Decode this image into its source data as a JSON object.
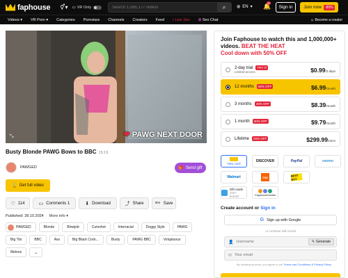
{
  "header": {
    "logo": "faphouse",
    "vr_only_label": "VR Only",
    "search_placeholder": "Search 1,586,177 videos",
    "language": "EN",
    "notification_count": "20",
    "signin_label": "Sign in",
    "join_label": "Join now",
    "join_discount": "-50%"
  },
  "nav": {
    "items": [
      "Videos",
      "VR Porn",
      "Categories",
      "Pornstars",
      "Channels",
      "Creators",
      "Feed"
    ],
    "live": "• Live Sex",
    "sex_chat": "Sex Chat",
    "creator_link": "Become a creator"
  },
  "video": {
    "watermark": "PAWG NEXT DOOR",
    "title": "Busty Blonde PAWG Bows to BBC",
    "duration": "15:19",
    "channel": "PAWGED",
    "send_gift": "Send gift",
    "full_video": "Get full video",
    "likes": "114",
    "comments": "Comments 1",
    "download": "Download",
    "share": "Share",
    "save": "Save",
    "published": "Published: 28.10.2024",
    "more_info": "More info",
    "tags": [
      "Blonde",
      "Blowjob",
      "Cumshot",
      "Interracial",
      "Doggy Style",
      "PAWG",
      "Big Tits",
      "BBC",
      "Ass",
      "Big Black Cock...",
      "Busty",
      "PAWG BBC",
      "Voluptuous",
      "Melons"
    ]
  },
  "panel": {
    "headline_1": "Join Faphouse to watch this and 1,000,000+ videos.",
    "headline_red": "BEAT THE HEAT",
    "headline_2": "Cool down with 50% OFF",
    "plans": [
      {
        "name": "2-day trial",
        "badge": "TRY IT",
        "sub": "Limited access",
        "price": "$0.99",
        "per": "/2 days",
        "selected": false
      },
      {
        "name": "12 months",
        "badge": "50% OFF",
        "sub": "",
        "price": "$6.99",
        "per": "/month",
        "selected": true
      },
      {
        "name": "3 months",
        "badge": "40% OFF",
        "sub": "",
        "price": "$8.39",
        "per": "/month",
        "selected": false
      },
      {
        "name": "1 month",
        "badge": "30% OFF",
        "sub": "",
        "price": "$9.79",
        "per": "/month",
        "selected": false
      },
      {
        "name": "Lifetime",
        "badge": "25% OFF",
        "sub": "",
        "price": "$299.99",
        "per": "/once",
        "selected": false
      }
    ],
    "payment": {
      "new_card": "New card",
      "discover": "DISCOVER",
      "paypal": "PayPal",
      "venmo": "venmo",
      "walmart": "Walmart",
      "homedepot": "THD",
      "bestbuy": "BEST BUY",
      "gift_cards": "Gift cards",
      "gift_sub": "150+ brands",
      "crypto": "Cryptocurrencies"
    },
    "account_text": "Create account or",
    "signin_link": "Sign in",
    "google": "Sign up with Google",
    "or_email": "or continue with email",
    "username_placeholder": "Username",
    "generate": "Generate",
    "email_placeholder": "Your email",
    "terms_prefix": "By creating account, you agree to our",
    "terms_link": "Terms and Conditions & Privacy Policy"
  },
  "colors": {
    "brand_yellow": "#f7c400",
    "red": "#e3263b",
    "purple": "#a24fd8",
    "link_blue": "#2d6ef5"
  }
}
